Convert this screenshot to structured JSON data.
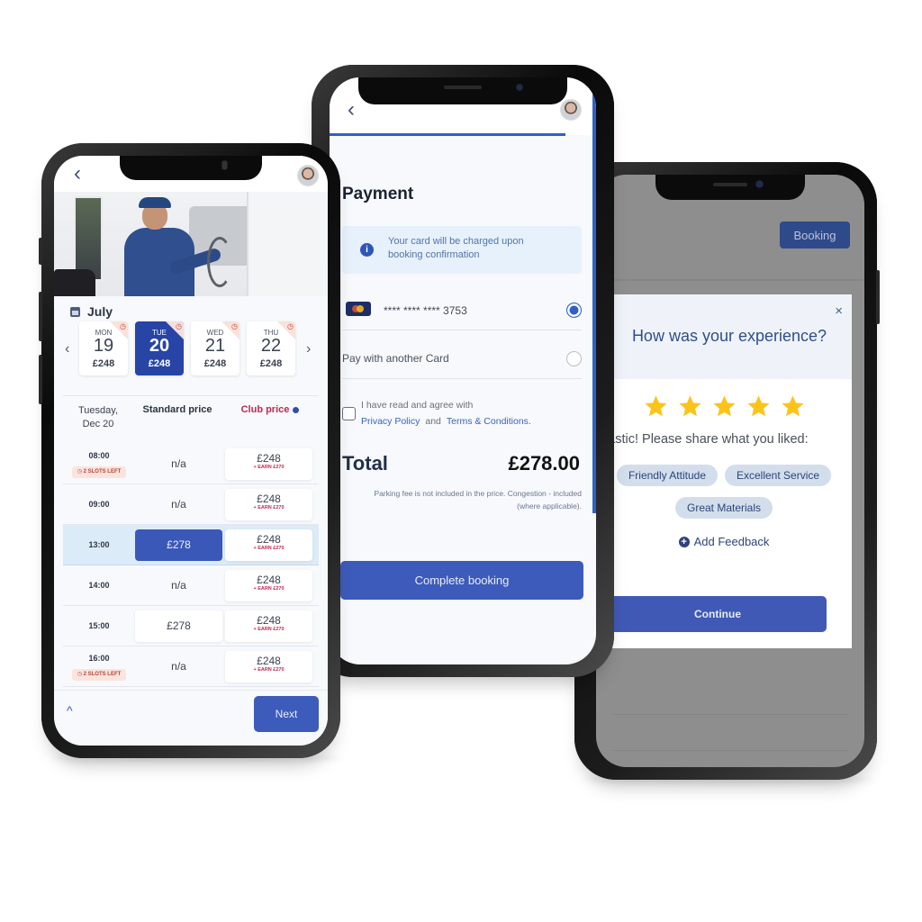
{
  "booking_screen": {
    "month": "July",
    "dates": [
      {
        "dow": "MON",
        "day": "19",
        "price": "£248",
        "selected": false
      },
      {
        "dow": "TUE",
        "day": "20",
        "price": "£248",
        "selected": true
      },
      {
        "dow": "WED",
        "day": "21",
        "price": "£248",
        "selected": false
      },
      {
        "dow": "THU",
        "day": "22",
        "price": "£248",
        "selected": false
      }
    ],
    "date_prev": "‹",
    "date_next": "›",
    "table_header": {
      "date_line1": "Tuesday,",
      "date_line2": "Dec 20",
      "standard": "Standard price",
      "club": "Club price"
    },
    "slots": [
      {
        "time": "08:00",
        "badge": "2 SLOTS LEFT",
        "standard": "n/a",
        "club_price": "£248",
        "club_earn": "+ EARN £270"
      },
      {
        "time": "09:00",
        "badge": "",
        "standard": "n/a",
        "club_price": "£248",
        "club_earn": "+ EARN £270"
      },
      {
        "time": "13:00",
        "badge": "",
        "standard": "£278",
        "club_price": "£248",
        "club_earn": "+ EARN £270"
      },
      {
        "time": "14:00",
        "badge": "",
        "standard": "n/a",
        "club_price": "£248",
        "club_earn": "+ EARN £270"
      },
      {
        "time": "15:00",
        "badge": "",
        "standard": "£278",
        "club_price": "£248",
        "club_earn": "+ EARN £270"
      },
      {
        "time": "16:00",
        "badge": "2 SLOTS LEFT",
        "standard": "n/a",
        "club_price": "£248",
        "club_earn": "+ EARN £270"
      }
    ],
    "back_icon": "‹",
    "up_icon": "^",
    "next_label": "Next"
  },
  "payment_screen": {
    "back_icon": "‹",
    "title": "Payment",
    "info_icon": "i",
    "info_line1": "Your card will be charged upon",
    "info_line2": "booking confirmation",
    "saved_card": "**** **** **** 3753",
    "saved_card_selected": true,
    "another_card_label": "Pay with another Card",
    "agree_line1": "I have read and agree with",
    "privacy_link": "Privacy Policy",
    "and_text": "and",
    "terms_link": "Terms & Conditions.",
    "total_label": "Total",
    "total_value": "£278.00",
    "fee_note_line1": "Parking fee is not included in the price. Congestion - included",
    "fee_note_line2": "(where applicable).",
    "complete_label": "Complete booking"
  },
  "feedback_screen": {
    "booking_button": "Booking",
    "close_icon": "×",
    "title": "How was your experience?",
    "rating": 5,
    "rating_max": 5,
    "share_text": "antastic! Please share what you liked:",
    "chips": [
      "Friendly Attitude",
      "Excellent Service",
      "Great Materials"
    ],
    "add_feedback_icon": "+",
    "add_feedback": "Add Feedback",
    "continue_label": "Continue"
  },
  "colors": {
    "primary": "#3d5bba",
    "selected_date": "#2744a6",
    "club_price": "#c2284e",
    "star": "#fcc419",
    "chip_bg": "#d2deeb"
  }
}
